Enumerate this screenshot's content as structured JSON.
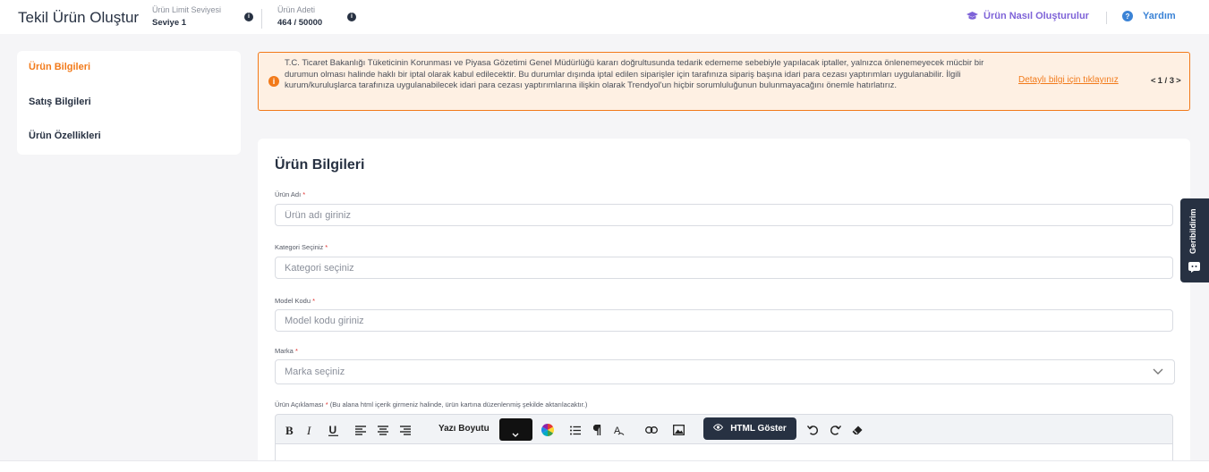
{
  "header": {
    "title": "Tekil Ürün Oluştur",
    "limit_label": "Ürün Limit Seviyesi",
    "limit_value": "Seviye 1",
    "count_label": "Ürün Adeti",
    "count_value": "464 / 50000",
    "how_to_link": "Ürün Nasıl Oluşturulur",
    "help_link": "Yardım"
  },
  "sidebar": {
    "items": [
      {
        "label": "Ürün Bilgileri",
        "active": true
      },
      {
        "label": "Satış Bilgileri",
        "active": false
      },
      {
        "label": "Ürün Özellikleri",
        "active": false
      }
    ]
  },
  "banner": {
    "text": "T.C. Ticaret Bakanlığı Tüketicinin Korunması ve Piyasa Gözetimi Genel Müdürlüğü kararı doğrultusunda tedarik edememe sebebiyle yapılacak iptaller, yalnızca önlenemeyecek mücbir bir durumun olması halinde haklı bir iptal olarak kabul edilecektir. Bu durumlar dışında iptal edilen siparişler için tarafınıza sipariş başına idari para cezası yaptırımları uygulanabilir. İlgili kurum/kuruluşlarca tarafınıza uygulanabilecek idari para cezası yaptırımlarına ilişkin olarak Trendyol'un hiçbir sorumluluğunun bulunmayacağını önemle hatırlatırız.",
    "link": "Detaylı bilgi için tıklayınız",
    "pager_prev": "<",
    "pager_text": "1 / 3",
    "pager_next": ">"
  },
  "form": {
    "title": "Ürün Bilgileri",
    "product_name": {
      "label": "Ürün Adı",
      "required": "*",
      "placeholder": "Ürün adı giriniz",
      "value": ""
    },
    "category": {
      "label": "Kategori Seçiniz",
      "required": "*",
      "placeholder": "Kategori seçiniz",
      "value": ""
    },
    "model_code": {
      "label": "Model Kodu",
      "required": "*",
      "placeholder": "Model kodu giriniz",
      "value": ""
    },
    "brand": {
      "label": "Marka",
      "required": "*",
      "placeholder": "Marka seçiniz"
    },
    "description": {
      "label": "Ürün Açıklaması",
      "required": "*",
      "note": "(Bu alana html içerik girmeniz halinde, ürün kartına düzenlenmiş şekilde aktarılacaktır.)"
    }
  },
  "editor": {
    "font_size_label": "Yazı Boyutu",
    "html_button": "HTML Göster"
  },
  "feedback": {
    "label": "Geribildirim"
  },
  "colors": {
    "accent": "#f27a1a",
    "dark": "#273142",
    "purple": "#7e63d8",
    "blue": "#3b83d6",
    "banner_bg": "#fef0e3",
    "required": "#e0312f"
  },
  "icons": [
    "info-icon",
    "graduation-cap-icon",
    "question-icon",
    "warning-icon",
    "chevron-down-icon",
    "bold-icon",
    "italic-icon",
    "underline-icon",
    "align-left-icon",
    "align-center-icon",
    "align-right-icon",
    "color-wheel-icon",
    "list-icon",
    "paragraph-icon",
    "text-format-icon",
    "link-icon",
    "image-icon",
    "eye-icon",
    "undo-icon",
    "redo-icon",
    "eraser-icon",
    "feedback-icon"
  ]
}
